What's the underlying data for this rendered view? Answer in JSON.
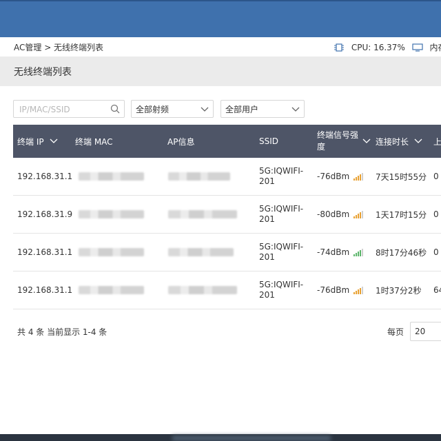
{
  "breadcrumb": "AC管理 > 无线终端列表",
  "system": {
    "cpu": "CPU: 16.37%",
    "memory": "内存:"
  },
  "page_title": "无线终端列表",
  "filters": {
    "search_placeholder": "IP/MAC/SSID",
    "radio_select": "全部射频",
    "user_select": "全部用户"
  },
  "table": {
    "columns": [
      "终端 IP",
      "终端 MAC",
      "AP信息",
      "SSID",
      "终端信号强度",
      "连接时长",
      "上"
    ],
    "rows": [
      {
        "ip": "192.168.31.1",
        "ssid": "5G:IQWIFI-201",
        "signal": "-76dBm",
        "signal_level": "medium",
        "duration": "7天15时55分",
        "up": "0"
      },
      {
        "ip": "192.168.31.9",
        "ssid": "5G:IQWIFI-201",
        "signal": "-80dBm",
        "signal_level": "medium",
        "duration": "1天17时15分",
        "up": "0"
      },
      {
        "ip": "192.168.31.1",
        "ssid": "5G:IQWIFI-201",
        "signal": "-74dBm",
        "signal_level": "good",
        "duration": "8时17分46秒",
        "up": "0"
      },
      {
        "ip": "192.168.31.1",
        "ssid": "5G:IQWIFI-201",
        "signal": "-76dBm",
        "signal_level": "medium",
        "duration": "1时37分2秒",
        "up": "64"
      }
    ]
  },
  "footer": {
    "count": "共 4 条 当前显示 1-4 条",
    "per_page_label": "每页",
    "per_page_value": "20"
  },
  "colors": {
    "header_blue": "#3f71ad",
    "table_header": "#4e5567",
    "signal_orange": "#e8a030",
    "signal_green": "#5bb56a"
  },
  "icons": [
    "cpu-icon",
    "memory-icon",
    "search-icon",
    "chevron-down-icon",
    "signal-icon"
  ]
}
